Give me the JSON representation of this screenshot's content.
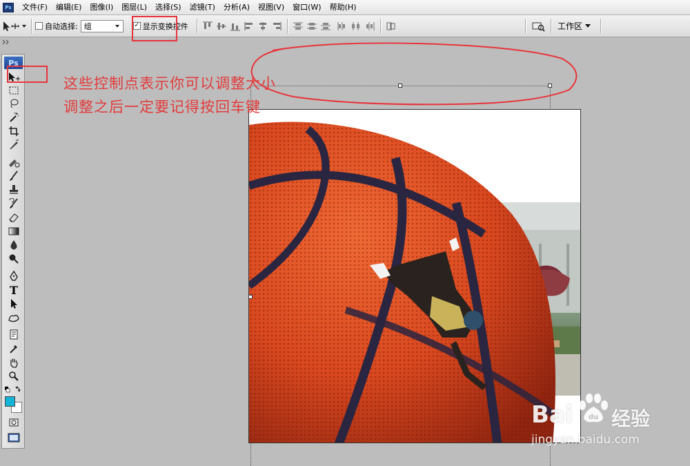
{
  "menu": {
    "items": [
      "文件(F)",
      "编辑(E)",
      "图像(I)",
      "图层(L)",
      "选择(S)",
      "滤镜(T)",
      "分析(A)",
      "视图(V)",
      "窗口(W)",
      "帮助(H)"
    ]
  },
  "options": {
    "auto_select_label": "自动选择:",
    "group_value": "组",
    "show_transform_label": "显示变换控件",
    "workspace_label": "工作区"
  },
  "toolbox": {
    "logo": "Ps",
    "tools": [
      "move-tool-icon",
      "marquee-tool-icon",
      "lasso-tool-icon",
      "magic-wand-icon",
      "crop-tool-icon",
      "slice-tool-icon",
      "healing-brush-icon",
      "brush-tool-icon",
      "clone-stamp-icon",
      "history-brush-icon",
      "eraser-icon",
      "gradient-tool-icon",
      "blur-tool-icon",
      "dodge-tool-icon",
      "pen-tool-icon",
      "type-tool-icon",
      "path-selection-icon",
      "custom-shape-icon",
      "notes-tool-icon",
      "eyedropper-icon",
      "hand-tool-icon",
      "zoom-tool-icon"
    ],
    "foreground_color": "#14b4d8",
    "background_color": "#ffffff"
  },
  "annotation": {
    "line1": "这些控制点表示你可以调整大小",
    "line2": "调整之后一定要记得按回车键",
    "color": "#e23b3b"
  },
  "watermark": {
    "brand": "Bai",
    "brand_suffix": "经验",
    "url": "jingyan.baidu.com"
  },
  "colors": {
    "highlight_box": "#e8333a",
    "ball": "#d9481f"
  }
}
